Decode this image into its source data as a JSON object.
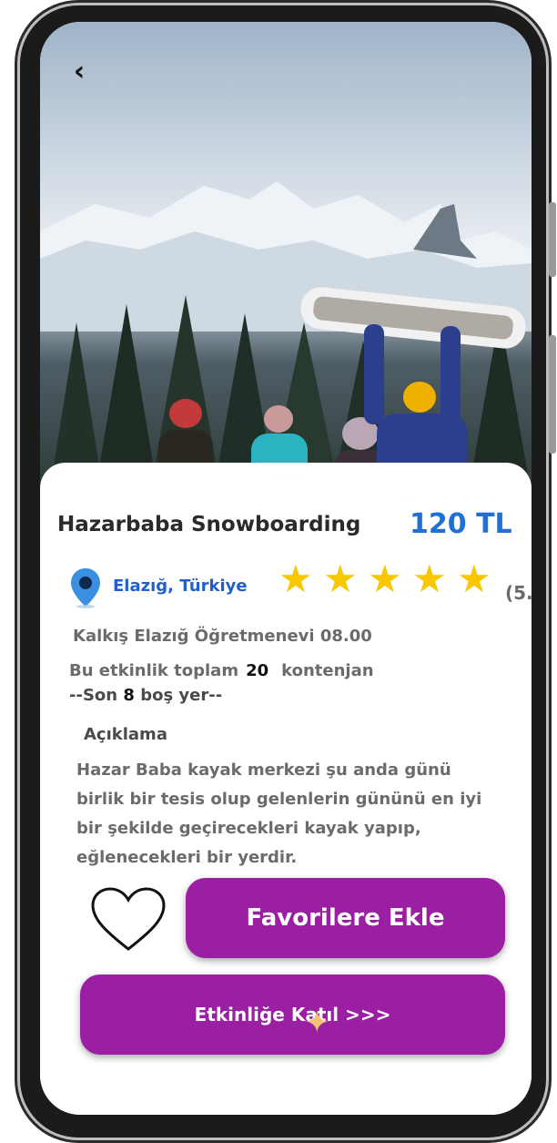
{
  "event": {
    "title": "Hazarbaba Snowboarding",
    "price": "120 TL",
    "location": "Elazığ, Türkiye",
    "rating_stars": 5,
    "rating_text": "(5."
  },
  "details": {
    "departure": "Kalkış Elazığ Öğretmenevi 08.00",
    "capacity_prefix": "Bu etkinlik toplam",
    "capacity_value": "20",
    "capacity_suffix": "kontenjan",
    "remaining_prefix": "--Son",
    "remaining_value": "8",
    "remaining_suffix": "boş yer--"
  },
  "description": {
    "heading": "Açıklama",
    "lines": [
      " Hazar Baba kayak merkezi şu anda günü",
      "birlik bir tesis olup gelenlerin gününü en iyi",
      "bir şekilde    geçirecekleri kayak yapıp,",
      "eğlenecekleri bir yerdir."
    ]
  },
  "actions": {
    "favorite_label": "Favorilere Ekle",
    "join_label": "Etkinliğe Katıl >>>"
  },
  "icons": {
    "back": "back-chevron-icon",
    "location": "location-pin-icon",
    "star": "star-icon",
    "heart": "heart-outline-icon"
  },
  "colors": {
    "primary_button": "#9b1fa3",
    "price": "#1f6fd6",
    "location": "#1f5fd0",
    "star": "#f7c800"
  }
}
